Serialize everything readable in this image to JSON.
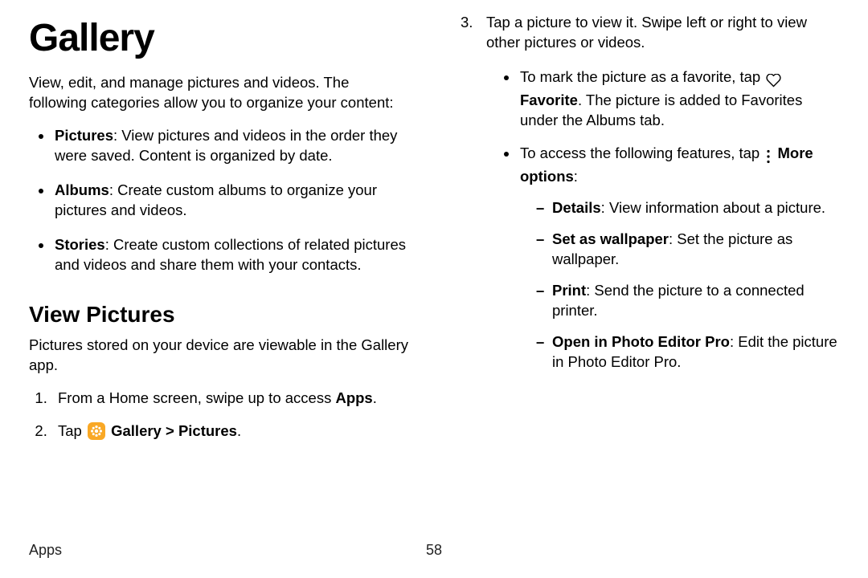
{
  "page": {
    "title": "Gallery",
    "intro": "View, edit, and manage pictures and videos. The following categories allow you to organize your content:",
    "cats": {
      "pictures_b": "Pictures",
      "pictures_t": ": View pictures and videos in the order they were saved. Content is organized by date.",
      "albums_b": "Albums",
      "albums_t": ": Create custom albums to organize your pictures and videos.",
      "stories_b": "Stories",
      "stories_t": ": Create custom collections of related pictures and videos and share them with your contacts."
    },
    "view_h": "View Pictures",
    "view_p": "Pictures stored on your device are viewable in the Gallery app.",
    "step1_a": "From a Home screen, swipe up to access ",
    "step1_b": "Apps",
    "step1_c": ".",
    "step2_a": "Tap ",
    "step2_b": "Gallery",
    "step2_c": " > ",
    "step2_d": "Pictures",
    "step2_e": ".",
    "step3": "Tap a picture to view it. Swipe left or right to view other pictures or videos.",
    "fav_a": "To mark the picture as a favorite, tap ",
    "fav_b": "Favorite",
    "fav_c": ". The picture is added to Favorites under the Albums tab.",
    "more_a": "To access the following features, tap ",
    "more_b": "More options",
    "more_c": ":",
    "details_b": "Details",
    "details_t": ": View information about a picture.",
    "wall_b": "Set as wallpaper",
    "wall_t": ": Set the picture as wallpaper.",
    "print_b": "Print",
    "print_t": ": Send the picture to a connected printer.",
    "open_b": "Open in Photo Editor Pro",
    "open_t": ": Edit the picture in Photo Editor Pro."
  },
  "footer": {
    "section": "Apps",
    "pagenum": "58"
  }
}
